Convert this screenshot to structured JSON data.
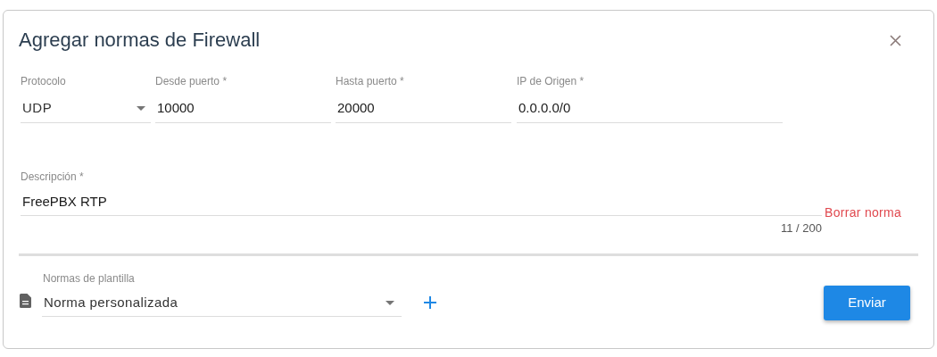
{
  "dialog": {
    "title": "Agregar normas de Firewall"
  },
  "fields": [
    {
      "kind": "select",
      "label": "Protocolo",
      "value": "UDP"
    },
    {
      "kind": "text",
      "label": "Desde puerto *",
      "value": "10000"
    },
    {
      "kind": "text",
      "label": "Hasta puerto *",
      "value": "20000"
    },
    {
      "kind": "text",
      "label": "IP de Origen *",
      "value": "0.0.0.0/0"
    }
  ],
  "description": {
    "label": "Descripción *",
    "value": "FreePBX RTP",
    "counter": "11 / 200"
  },
  "delete_link": "Borrar norma",
  "template": {
    "label": "Normas de plantilla",
    "value": "Norma personalizada"
  },
  "submit": "Enviar"
}
